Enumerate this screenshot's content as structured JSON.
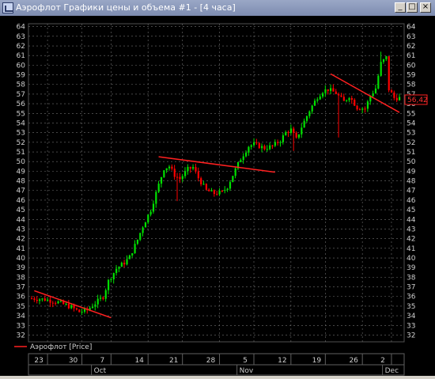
{
  "window": {
    "title": "Аэрофлот Графики цены и объема #1 - [4 часа]",
    "buttons": {
      "minimize": "_",
      "maximize": "□",
      "close": "×"
    }
  },
  "chart": {
    "legend_label": "Аэрофлот [Price]",
    "last_price_label": "56,42",
    "x_day_labels": [
      "23",
      "30",
      "7",
      "14",
      "21",
      "28",
      "5",
      "12",
      "19",
      "26",
      "2"
    ],
    "x_month_labels": [
      "Oct",
      "Nov",
      "Dec"
    ],
    "colors": {
      "up": "#00e000",
      "down": "#ff0000",
      "trend": "#ff2020",
      "grid": "#707070",
      "background": "#000000",
      "axis_text": "#cfcfcf"
    }
  },
  "chart_data": {
    "type": "candlestick",
    "ylim": [
      31.3,
      64.3
    ],
    "yticks": [
      32,
      33,
      34,
      35,
      36,
      37,
      38,
      39,
      40,
      41,
      42,
      43,
      44,
      45,
      46,
      47,
      48,
      49,
      50,
      51,
      52,
      53,
      54,
      55,
      56,
      57,
      58,
      59,
      60,
      61,
      62,
      63,
      64
    ],
    "x_ticks": [
      {
        "label": "23",
        "i": 6
      },
      {
        "label": "30",
        "i": 19
      },
      {
        "label": "7",
        "i": 30
      },
      {
        "label": "14",
        "i": 44
      },
      {
        "label": "21",
        "i": 57
      },
      {
        "label": "28",
        "i": 71
      },
      {
        "label": "5",
        "i": 84
      },
      {
        "label": "12",
        "i": 98
      },
      {
        "label": "19",
        "i": 111
      },
      {
        "label": "26",
        "i": 125
      },
      {
        "label": "2",
        "i": 136
      }
    ],
    "months": [
      {
        "label": "Oct",
        "i": 25
      },
      {
        "label": "Nov",
        "i": 80
      },
      {
        "label": "Dec",
        "i": 135
      }
    ],
    "price_keypoints": [
      [
        0,
        35.8
      ],
      [
        5,
        35.7
      ],
      [
        10,
        35.4
      ],
      [
        15,
        34.9
      ],
      [
        18,
        34.4
      ],
      [
        21,
        34.6
      ],
      [
        24,
        35.3
      ],
      [
        27,
        36.0
      ],
      [
        29,
        37.6
      ],
      [
        32,
        38.9
      ],
      [
        35,
        39.5
      ],
      [
        37,
        40.1
      ],
      [
        40,
        41.9
      ],
      [
        42,
        43.3
      ],
      [
        45,
        45.0
      ],
      [
        48,
        47.6
      ],
      [
        50,
        49.3
      ],
      [
        52,
        49.5
      ],
      [
        54,
        48.6
      ],
      [
        56,
        48.2
      ],
      [
        59,
        49.2
      ],
      [
        61,
        49.4
      ],
      [
        63,
        48.3
      ],
      [
        66,
        47.0
      ],
      [
        69,
        46.7
      ],
      [
        72,
        46.8
      ],
      [
        74,
        47.4
      ],
      [
        76,
        48.6
      ],
      [
        79,
        50.3
      ],
      [
        82,
        51.6
      ],
      [
        84,
        51.8
      ],
      [
        88,
        51.4
      ],
      [
        91,
        51.6
      ],
      [
        94,
        52.2
      ],
      [
        96,
        53.0
      ],
      [
        98,
        53.3
      ],
      [
        100,
        52.3
      ],
      [
        102,
        53.6
      ],
      [
        105,
        55.3
      ],
      [
        108,
        56.7
      ],
      [
        110,
        57.3
      ],
      [
        112,
        57.5
      ],
      [
        115,
        57.1
      ],
      [
        118,
        56.2
      ],
      [
        120,
        56.8
      ],
      [
        123,
        55.6
      ],
      [
        126,
        55.5
      ],
      [
        128,
        56.8
      ],
      [
        130,
        57.6
      ],
      [
        132,
        60.2
      ],
      [
        134,
        60.8
      ],
      [
        135,
        57.5
      ],
      [
        137,
        56.6
      ],
      [
        139,
        56.6
      ]
    ],
    "spikes": [
      {
        "i": 116,
        "low": 52.5
      },
      {
        "i": 132,
        "high": 61.4
      },
      {
        "i": 99,
        "low": 51.1
      },
      {
        "i": 55,
        "low": 45.9
      }
    ],
    "trendlines": [
      {
        "from": [
          1,
          36.6
        ],
        "to": [
          30,
          33.8
        ]
      },
      {
        "from": [
          48,
          50.5
        ],
        "to": [
          92,
          48.9
        ]
      },
      {
        "from": [
          113,
          59.1
        ],
        "to": [
          139,
          55.1
        ]
      }
    ]
  }
}
